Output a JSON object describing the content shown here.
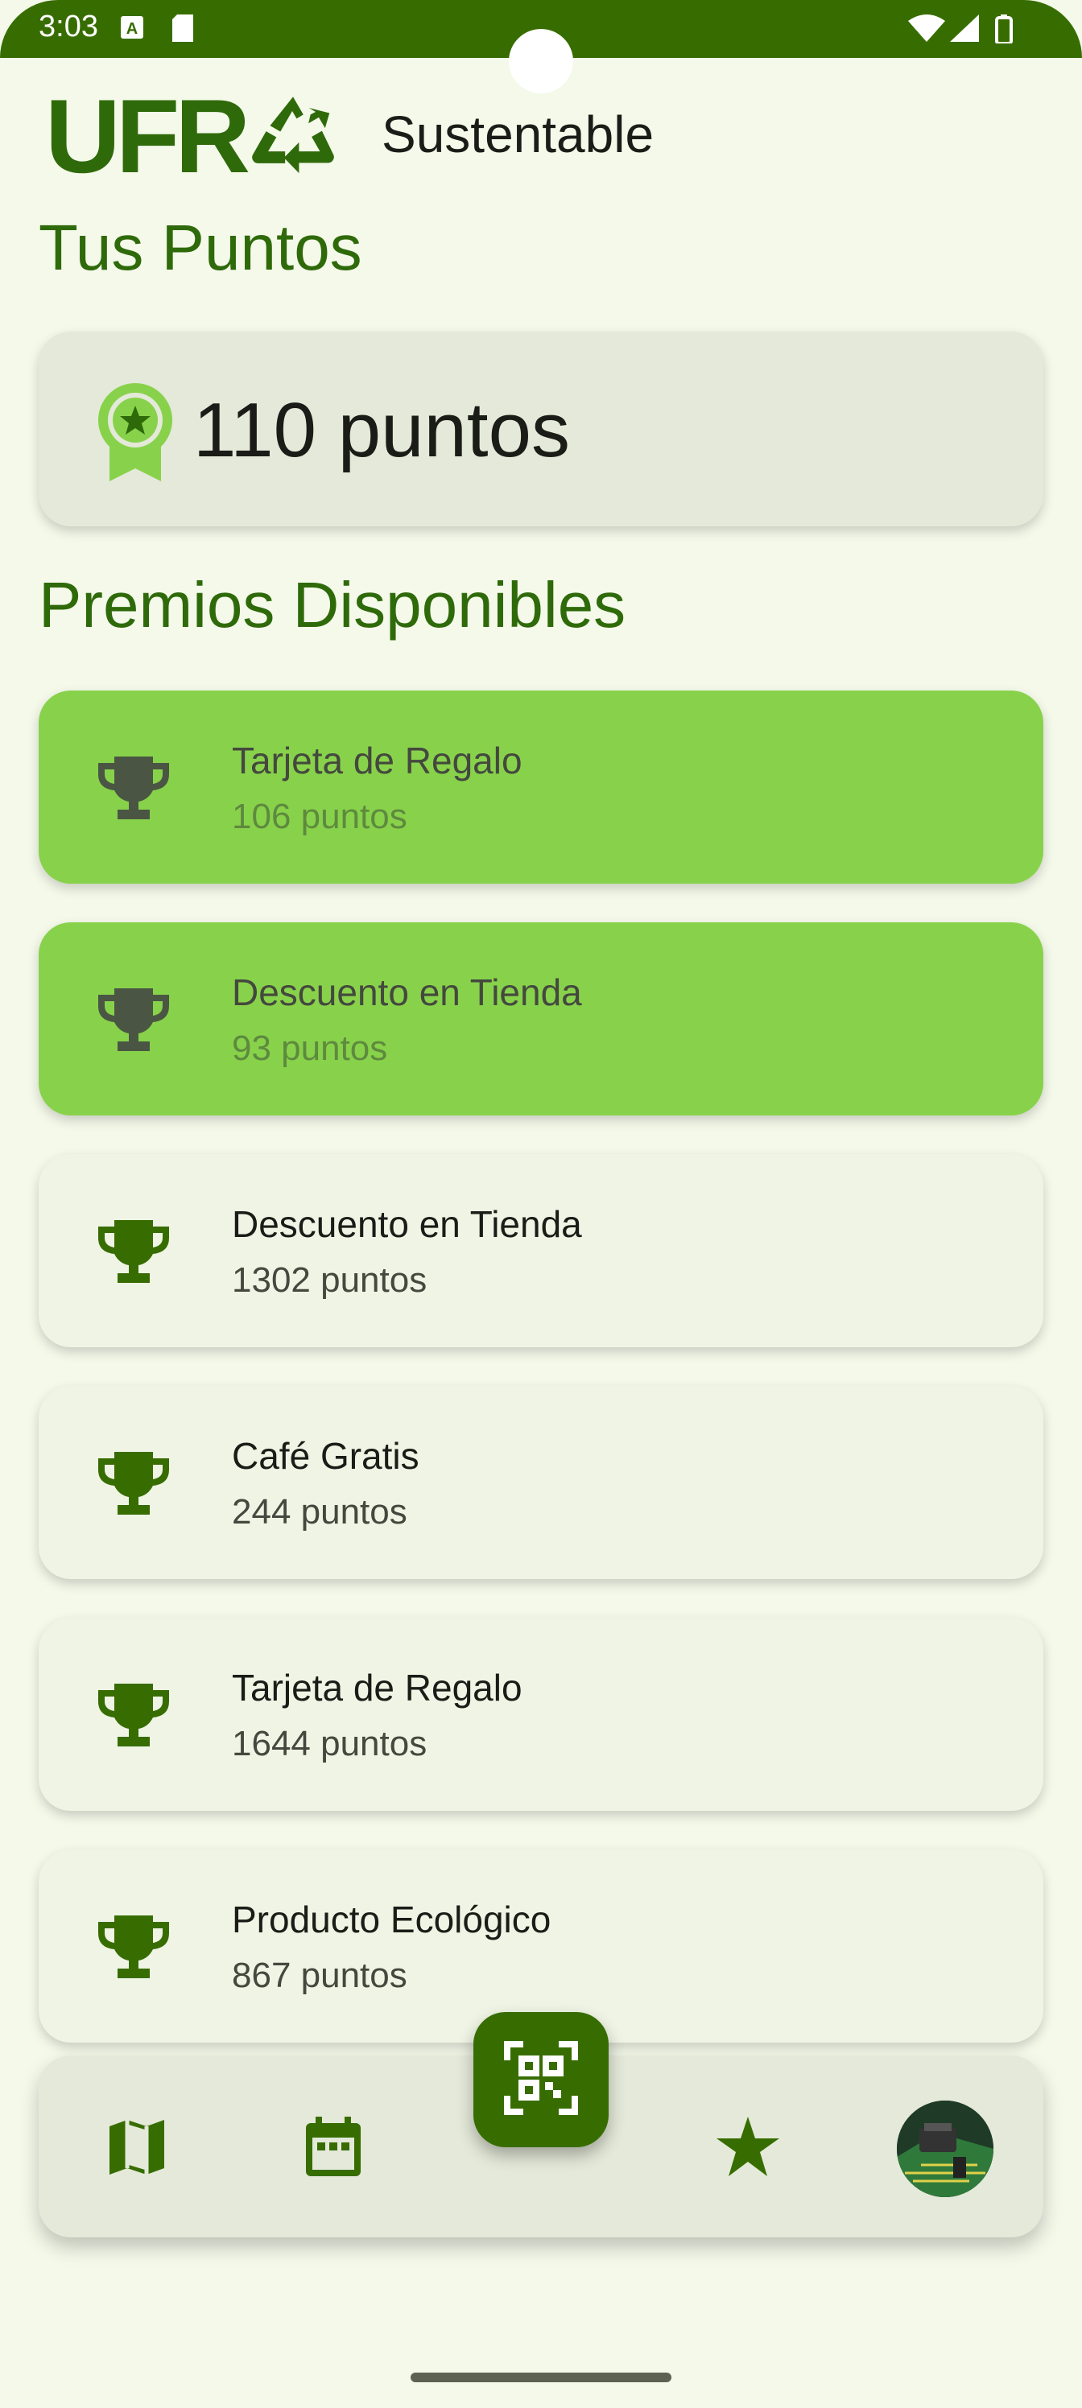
{
  "status": {
    "time": "3:03"
  },
  "header": {
    "logo_text": "UFR",
    "app_name": "Sustentable"
  },
  "points": {
    "title": "Tus Puntos",
    "value": "110 puntos"
  },
  "rewards": {
    "title": "Premios Disponibles",
    "items": [
      {
        "name": "Tarjeta de Regalo",
        "cost": "106 puntos",
        "state": "available"
      },
      {
        "name": "Descuento en Tienda",
        "cost": "93 puntos",
        "state": "available"
      },
      {
        "name": "Descuento en Tienda",
        "cost": "1302 puntos",
        "state": "locked"
      },
      {
        "name": "Café Gratis",
        "cost": "244 puntos",
        "state": "locked"
      },
      {
        "name": "Tarjeta de Regalo",
        "cost": "1644 puntos",
        "state": "locked"
      },
      {
        "name": "Producto Ecológico",
        "cost": "867 puntos",
        "state": "locked"
      }
    ]
  },
  "nav": {
    "items": [
      "map-icon",
      "calendar-icon",
      "qr-scan-icon",
      "star-icon",
      "profile-avatar"
    ]
  },
  "colors": {
    "primary": "#376d00",
    "title": "#2f6a0a",
    "highlight": "#88d24b",
    "card": "#eff4e4",
    "background": "#f4f9ea"
  }
}
